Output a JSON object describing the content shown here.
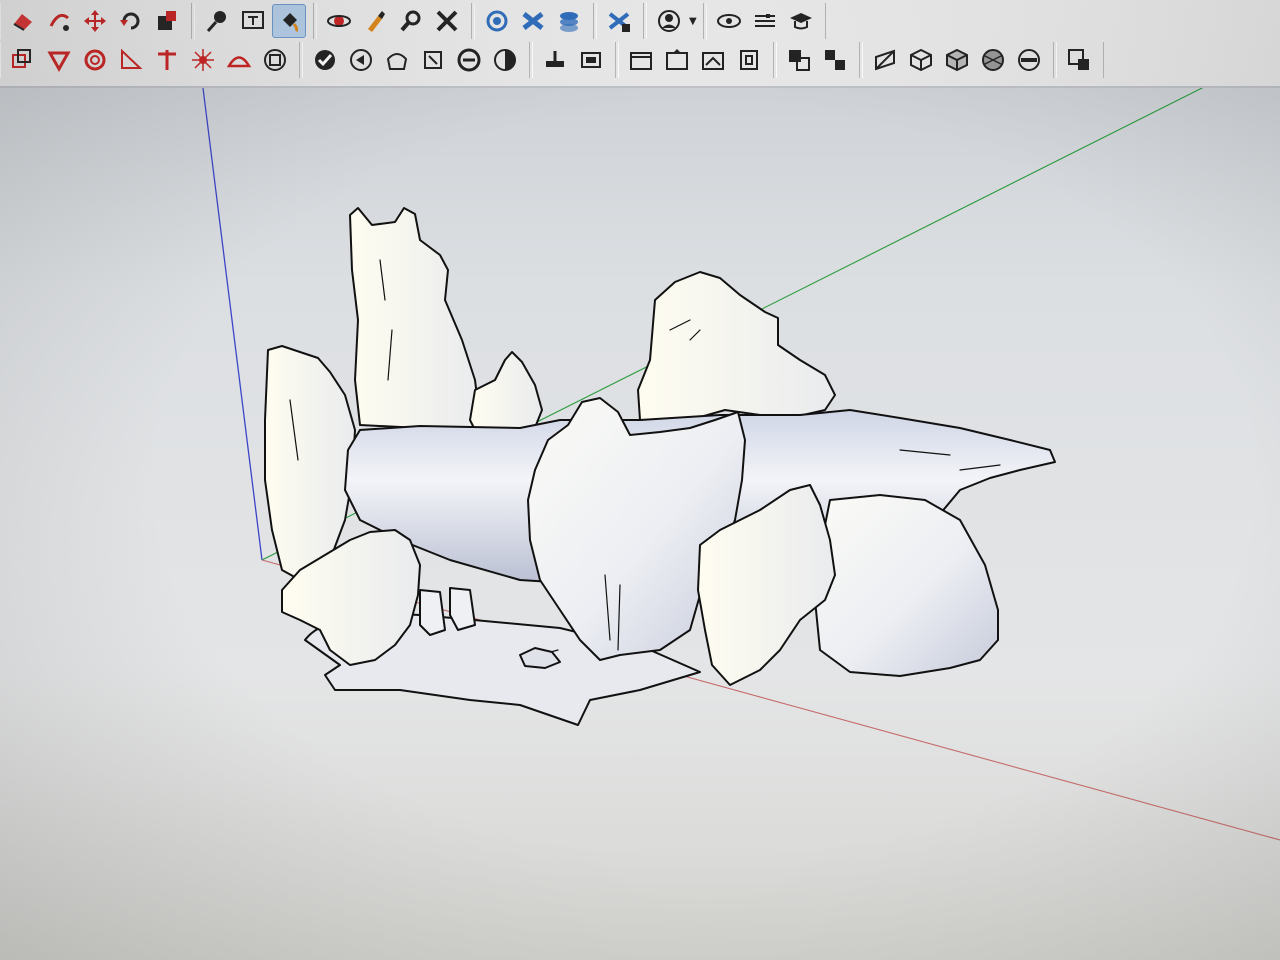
{
  "app": {
    "accent_color": "#2f6fc0",
    "icon_color": "#222222",
    "active_tool": "paint-bucket-icon"
  },
  "toolbar": {
    "row1_groups": [
      [
        "eraser-icon",
        "follow-me-icon",
        "move-icon",
        "rotate-icon",
        "scale-icon"
      ],
      [
        "tape-measure-icon",
        "text-icon",
        "paint-bucket-icon"
      ],
      [
        "orbit-icon",
        "paint-brush-icon",
        "zoom-icon",
        "zoom-extents-icon"
      ],
      [
        "warehouse-icon",
        "extension-icon",
        "components-icon"
      ],
      [
        "model-info-icon"
      ],
      [
        "user-account-icon"
      ],
      [
        "view-icon",
        "styles-icon",
        "graduate-icon"
      ]
    ],
    "row2_groups": [
      [
        "offset-icon",
        "push-pull-icon",
        "circle-tool-icon",
        "protractor-icon",
        "axes-icon",
        "sun-icon",
        "arc-icon",
        "cube-icon"
      ],
      [
        "check-icon",
        "position-camera-icon",
        "walk-icon",
        "look-around-icon",
        "section-plane-icon",
        "shadow-icon"
      ],
      [
        "section-display-icon",
        "section-fill-icon"
      ],
      [
        "iso-view-icon",
        "top-view-icon",
        "front-view-icon",
        "right-view-icon"
      ],
      [
        "back-edges-icon",
        "hidden-line-icon"
      ],
      [
        "xray-icon",
        "wireframe-icon",
        "shaded-icon",
        "textured-icon",
        "monochrome-icon"
      ],
      [
        "component-options-icon"
      ]
    ]
  },
  "viewport": {
    "background_top": "#c9cdd2",
    "background_bottom": "#d6d6d2",
    "axis_colors": {
      "blue": "#3b46c8",
      "green": "#2a9a3a",
      "red": "#c56a6a"
    },
    "model_fill": "#eef0f4",
    "model_shadow": "#aab0c4",
    "model_edge": "#111111"
  }
}
